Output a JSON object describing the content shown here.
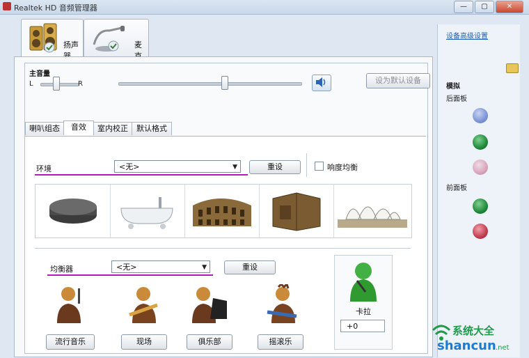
{
  "window": {
    "title": "Realtek HD 音频管理器",
    "controls": [
      "—",
      "▢",
      "✕"
    ]
  },
  "device_tabs": [
    {
      "label": "扬声器",
      "icon": "speaker-icon"
    },
    {
      "label": "麦克风",
      "icon": "microphone-icon"
    }
  ],
  "main_volume": {
    "label": "主音量",
    "left": "L",
    "right": "R",
    "set_default_label": "设为默认设备"
  },
  "sub_tabs": [
    "喇叭组态",
    "音效",
    "室内校正",
    "默认格式"
  ],
  "environment": {
    "label": "环境",
    "value": "<无>",
    "reset_label": "重设",
    "loudness_label": "响度均衡",
    "presets": [
      "stone-disc",
      "bathtub",
      "colosseum",
      "room",
      "opera-house"
    ]
  },
  "equalizer": {
    "label": "均衡器",
    "value": "<无>",
    "reset_label": "重设",
    "presets": [
      "流行音乐",
      "现场",
      "俱乐部",
      "摇滚乐"
    ],
    "karaoke_label": "卡拉",
    "karaoke_value": "+0"
  },
  "side": {
    "link": "设备高级设置",
    "analog_label": "模拟",
    "rear_label": "后面板",
    "front_label": "前面板",
    "jack_colors": {
      "blue": "#7c93d6",
      "green": "#1f8a3b",
      "pink": "#d8a6bd",
      "red": "#c23d4f"
    }
  },
  "watermark": {
    "brand": "系统大全",
    "site": "shancun",
    "suffix": ".net"
  },
  "colors": {
    "underline": "#b41ab9"
  }
}
